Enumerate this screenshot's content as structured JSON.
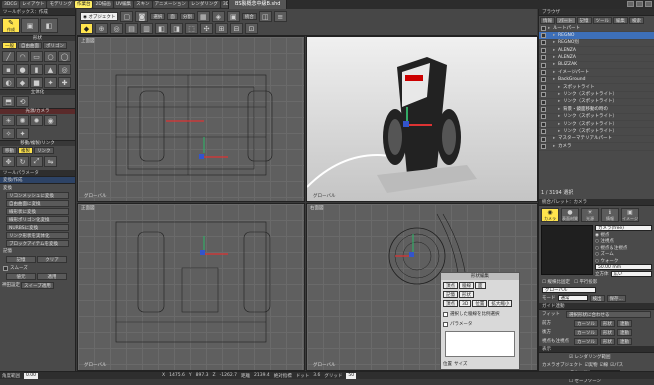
{
  "menubar": {
    "tabs": [
      "3DCG",
      "レイアウト",
      "モデリング",
      "作業台",
      "2D描画",
      "UV編集",
      "スキン",
      "アニメーション",
      "レンダリング",
      "3Dプリント"
    ],
    "active_tab": "作業台",
    "document_title": "BS製概念中級B.shd"
  },
  "tool_panel": {
    "header": "ツールボックス：作成",
    "mode_label": "作成",
    "shape_section": "形状",
    "shape_tabs": [
      "一般",
      "自由曲面",
      "ポリゴン"
    ],
    "solid_section": "立体化",
    "light_section": "光源/カメラ",
    "transform_section": "移動/複製/リンク",
    "transform_tabs": [
      "移動",
      "複製",
      "リンク"
    ],
    "params_header": "ツールパラメータ",
    "params_sub": "変換/作成",
    "params_title": "変換",
    "param_buttons": [
      "リコンメッシュに変換",
      "自由曲面に変換",
      "線形状に変換",
      "線形ポリゴン化変換",
      "NURBSに変換",
      "リンク形状を実体化",
      "ブロックアイテムを変換"
    ],
    "memory_label": "記憶",
    "memory_buttons": [
      "記憶",
      "クリア"
    ],
    "smooth_label": "スムーズ",
    "smooth_buttons": [
      "値元",
      "適用"
    ],
    "bottom_label": "神田設定",
    "bottom_button": "スイープ適用"
  },
  "toolbar": {
    "object_label": "オブジェクト",
    "mode_buttons": [
      "選択",
      "面",
      "分割"
    ],
    "buttons_row1": [
      "統合"
    ]
  },
  "viewports": [
    {
      "label": "上面図",
      "axis_label": "グローバル"
    },
    {
      "label": "透視図（カメラ(free)）",
      "axis_label": "グローバル"
    },
    {
      "label": "正面図",
      "axis_label": "グローバル"
    },
    {
      "label": "右面図",
      "axis_label": "グローバル"
    }
  ],
  "float_window": {
    "title": "形状編集",
    "tabs": [
      "頂点",
      "稜線",
      "面"
    ],
    "row2": [
      "記憶",
      "形状"
    ],
    "row3": [
      "頂点",
      "3D",
      "位置",
      "拡大縮小"
    ],
    "checkbox1": "選択した稜線を比例選択",
    "checkbox2": "パラメータ",
    "pos_label": "位置",
    "size_label": "サイズ"
  },
  "browser": {
    "header": "ブラウザ",
    "tabs": [
      "情報",
      "パート",
      "記憶",
      "ツール",
      "編集",
      "検索"
    ],
    "items": [
      {
        "label": "ルートパート",
        "indent": 0,
        "sel": false
      },
      {
        "label": "REGNO",
        "indent": 1,
        "sel": true
      },
      {
        "label": "REGNO別",
        "indent": 1,
        "sel": false
      },
      {
        "label": "ALENZA",
        "indent": 1,
        "sel": false
      },
      {
        "label": "ALENZA",
        "indent": 1,
        "sel": false
      },
      {
        "label": "BLIZZAK",
        "indent": 1,
        "sel": false
      },
      {
        "label": "イメージパート",
        "indent": 1,
        "sel": false
      },
      {
        "label": "BackGround",
        "indent": 1,
        "sel": false
      },
      {
        "label": "スポットライト",
        "indent": 2,
        "sel": false
      },
      {
        "label": "リンク（スポットライト）",
        "indent": 2,
        "sel": false
      },
      {
        "label": "リンク（スポットライト）",
        "indent": 2,
        "sel": false
      },
      {
        "label": "背景・鏡面移動の時の",
        "indent": 2,
        "sel": false
      },
      {
        "label": "リンク（スポットライト）",
        "indent": 2,
        "sel": false
      },
      {
        "label": "リンク（スポットライト）",
        "indent": 2,
        "sel": false
      },
      {
        "label": "リンク（スポットライト）",
        "indent": 2,
        "sel": false
      },
      {
        "label": "マスターマテリアルパート",
        "indent": 1,
        "sel": false
      },
      {
        "label": "カメラ",
        "indent": 1,
        "sel": false
      }
    ],
    "footer": "1 / 3194 選択"
  },
  "attributes": {
    "header": "統合パレット：カメラ",
    "tabs": [
      "カメラ",
      "表面材質",
      "光源",
      "情報",
      "イメージ"
    ],
    "camera_name": "カメラ(free)",
    "radio_options": [
      "視点",
      "注視点",
      "視点＆注視点",
      "ズーム",
      "ウォーク"
    ],
    "zoom_value": "50.00 mm",
    "options": [
      "立方体",
      "広い"
    ],
    "fixed_label": "縦横比固定",
    "parallel_label": "平行投影",
    "target_label": "グローバル",
    "mode_label": "モード",
    "mode_value": "通常",
    "buttons_a": [
      "検出",
      "保存..."
    ],
    "subheader": "ガイド連動",
    "fit_label": "フィット",
    "fit_value": "選択形状に合わせる",
    "rows": [
      {
        "label": "前方",
        "a": "カーソル",
        "b": "形状",
        "c": "連動"
      },
      {
        "label": "後方",
        "a": "カーソル",
        "b": "形状",
        "c": "連動"
      },
      {
        "label": "視点も注視点",
        "a": "カーソル",
        "b": "形状",
        "c": "連動"
      }
    ],
    "display_header": "表示",
    "render_label": "レンダリング範囲",
    "camera_obj_label": "カメラオブジェクト",
    "checks": [
      "実物",
      "線",
      "パス"
    ],
    "scale_label": "スケール",
    "scale_value": "1",
    "safe_label": "セーフゾーン"
  },
  "status": {
    "label": "角度範囲",
    "value": "0.00",
    "x_label": "X",
    "x": "1475.6",
    "y_label": "Y",
    "y": "897.3",
    "z_label": "Z",
    "z": "-1262.7",
    "dist_label": "距離",
    "dist": "2139.4",
    "abs_label": "絶対指標",
    "grid_label": "ドット",
    "grid_val": "3.6",
    "grid2_label": "グリッド",
    "grid2_val": "50"
  },
  "colors": {
    "accent": "#ffe44d",
    "panel": "#4a4a4a",
    "viewport": "#5f5f5f",
    "selection": "#3d6fb8"
  }
}
